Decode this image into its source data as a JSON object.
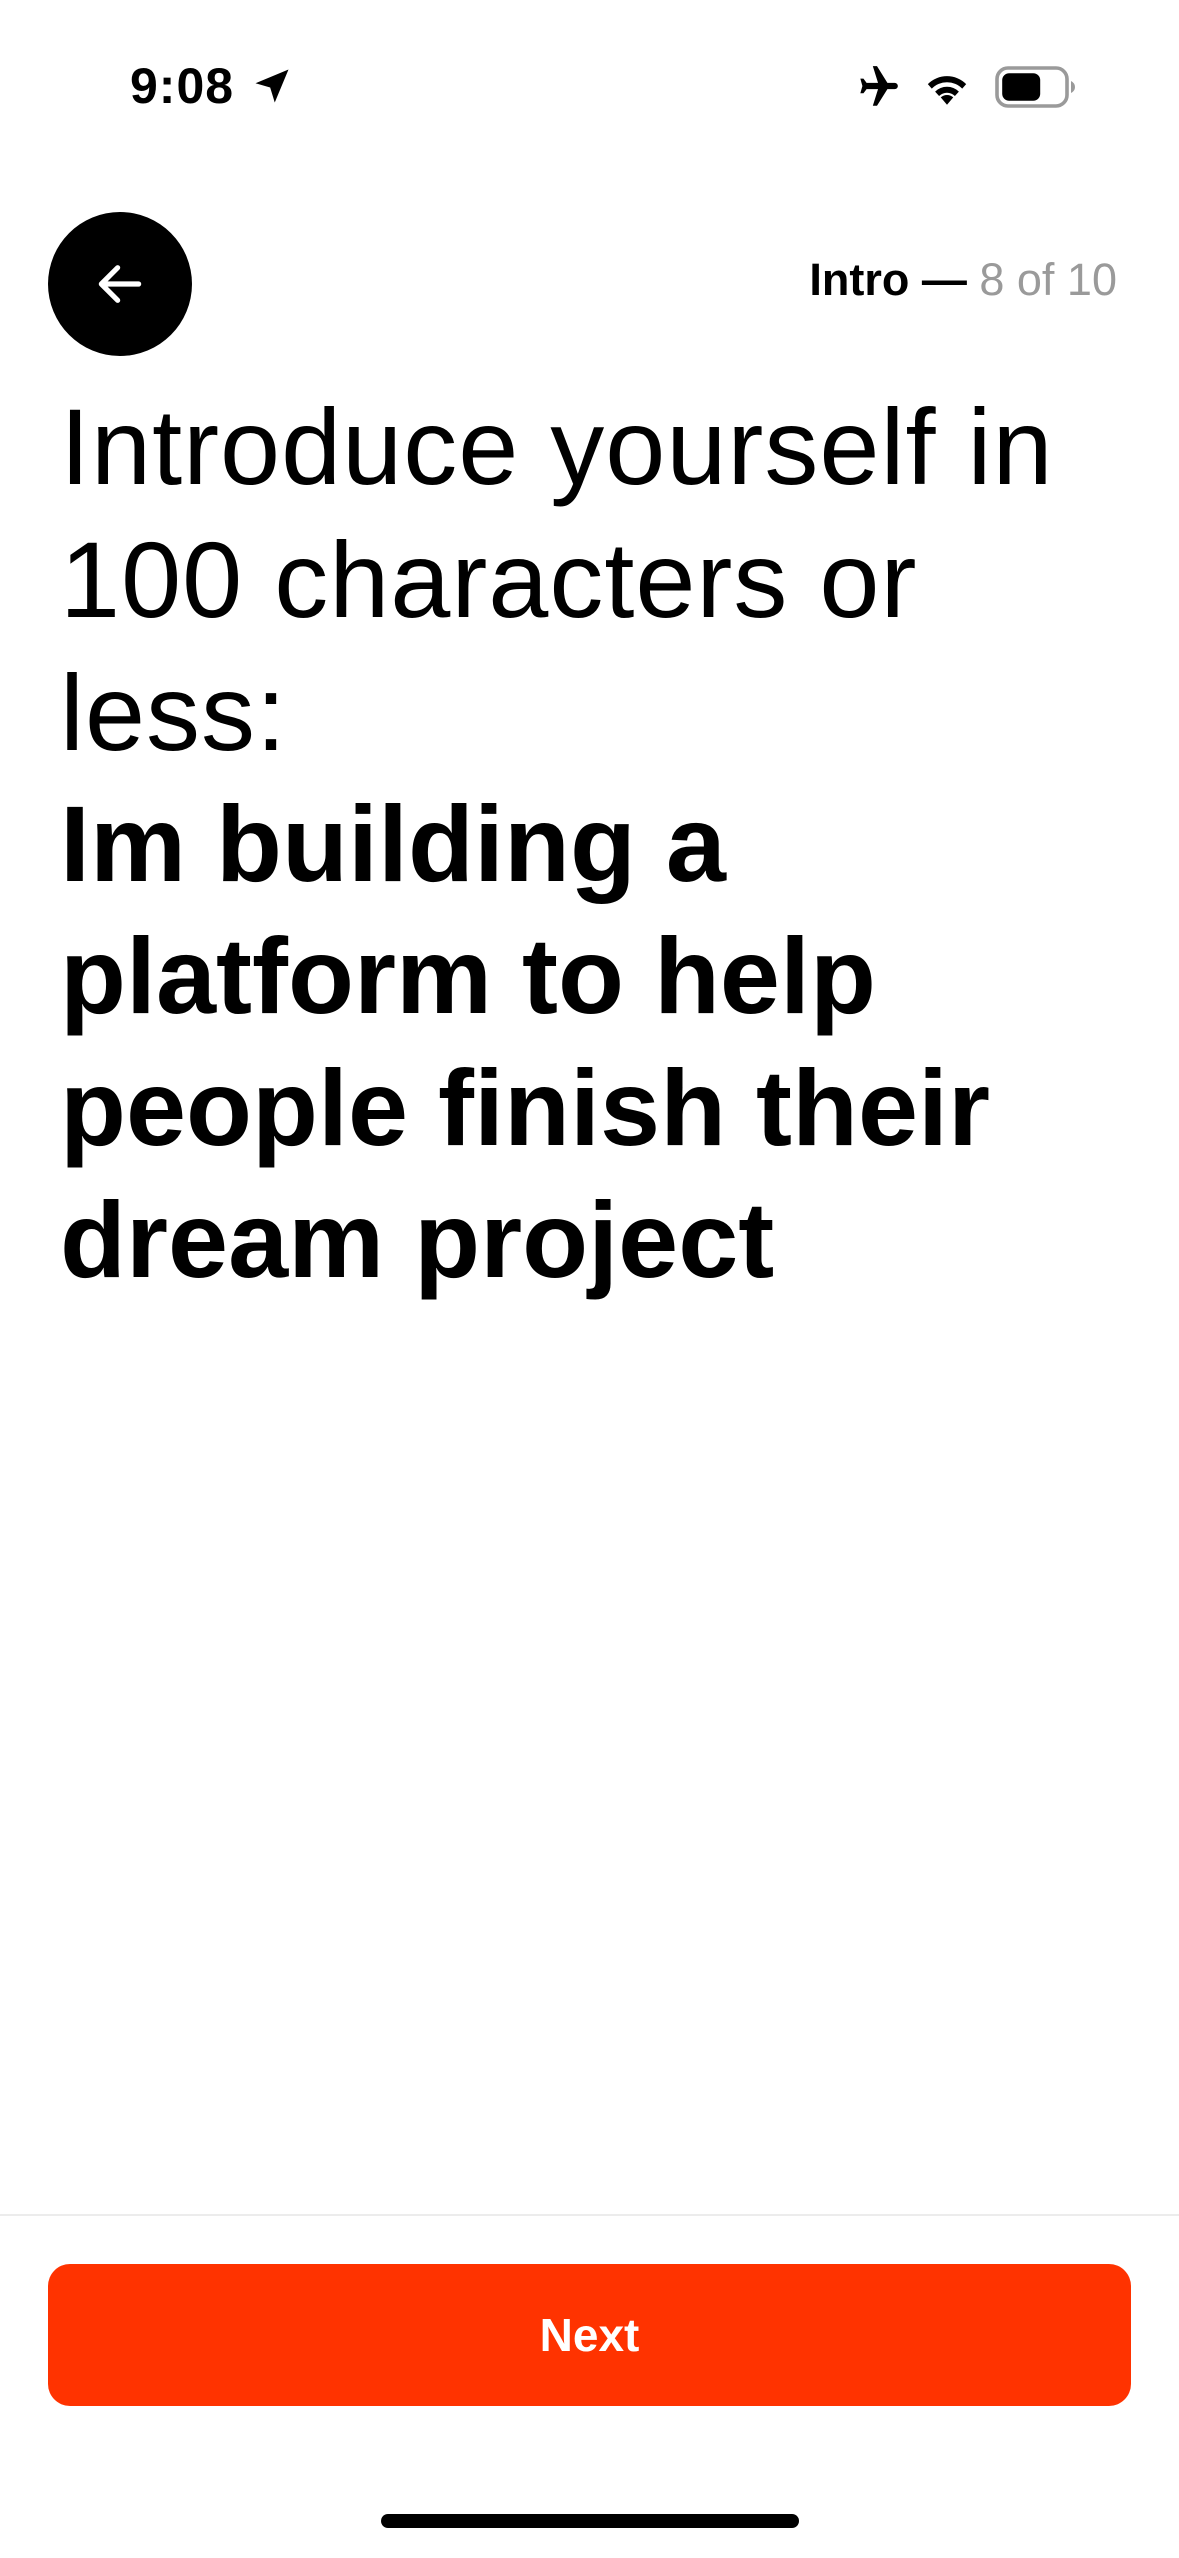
{
  "status_bar": {
    "time": "9:08",
    "icons": [
      "location-arrow-icon",
      "airplane-icon",
      "wifi-icon",
      "battery-icon"
    ]
  },
  "header": {
    "back_icon": "arrow-left-icon",
    "section": "Intro",
    "separator": " — ",
    "progress": "8 of 10"
  },
  "prompt": {
    "question": "Introduce yourself in 100 characters or less:",
    "answer": "Im building a platform to help people finish their dream project"
  },
  "footer": {
    "next_label": "Next"
  },
  "colors": {
    "accent": "#ff3300",
    "text": "#000000",
    "muted": "#9a9a9a",
    "background": "#ffffff"
  }
}
